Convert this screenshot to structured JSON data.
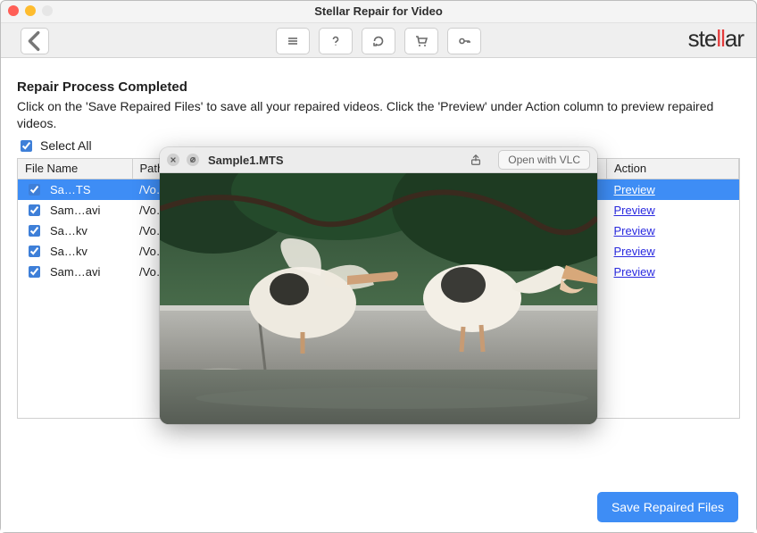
{
  "window": {
    "title": "Stellar Repair for Video"
  },
  "brand": "stellar",
  "main": {
    "heading": "Repair Process Completed",
    "subtext": "Click on the 'Save Repaired Files' to save all your repaired videos. Click the 'Preview' under Action column to preview repaired videos.",
    "select_all_label": "Select All"
  },
  "table": {
    "columns": {
      "filename": "File Name",
      "path": "Path",
      "action": "Action"
    },
    "rows": [
      {
        "checked": true,
        "filename": "Sa…TS",
        "path": "/Vo…",
        "action": "Preview",
        "selected": true
      },
      {
        "checked": true,
        "filename": "Sam…avi",
        "path": "/Vo…",
        "action": "Preview",
        "selected": false
      },
      {
        "checked": true,
        "filename": "Sa…kv",
        "path": "/Vo…",
        "action": "Preview",
        "selected": false
      },
      {
        "checked": true,
        "filename": "Sa…kv",
        "path": "/Vo…",
        "action": "Preview",
        "selected": false
      },
      {
        "checked": true,
        "filename": "Sam…avi",
        "path": "/Vo…",
        "action": "Preview",
        "selected": false
      }
    ]
  },
  "buttons": {
    "save": "Save Repaired Files"
  },
  "preview": {
    "title": "Sample1.MTS",
    "open_with": "Open with VLC"
  }
}
